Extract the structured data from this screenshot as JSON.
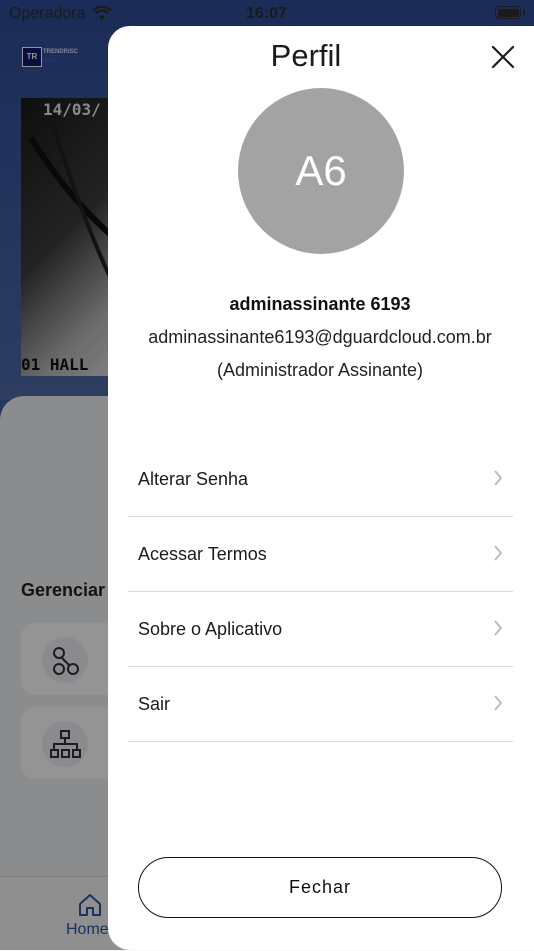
{
  "status_bar": {
    "carrier": "Operadora",
    "time": "16:07"
  },
  "background": {
    "logo_text": "TR",
    "logo_brand": "TRENDRISC",
    "camera": {
      "timestamp": "14/03/",
      "label": "01 HALL"
    },
    "section_title": "Gerenciar",
    "card_icons": [
      "graph-nodes-icon",
      "hierarchy-icon"
    ],
    "tab_home_label": "Home"
  },
  "profile": {
    "title": "Perfil",
    "avatar_initials": "A6",
    "name": "adminassinante 6193",
    "email": "adminassinante6193@dguardcloud.com.br",
    "role": "(Administrador Assinante)",
    "menu": [
      {
        "label": "Alterar Senha"
      },
      {
        "label": "Acessar Termos"
      },
      {
        "label": "Sobre o Aplicativo"
      },
      {
        "label": "Sair"
      }
    ],
    "close_button": "Fechar"
  }
}
